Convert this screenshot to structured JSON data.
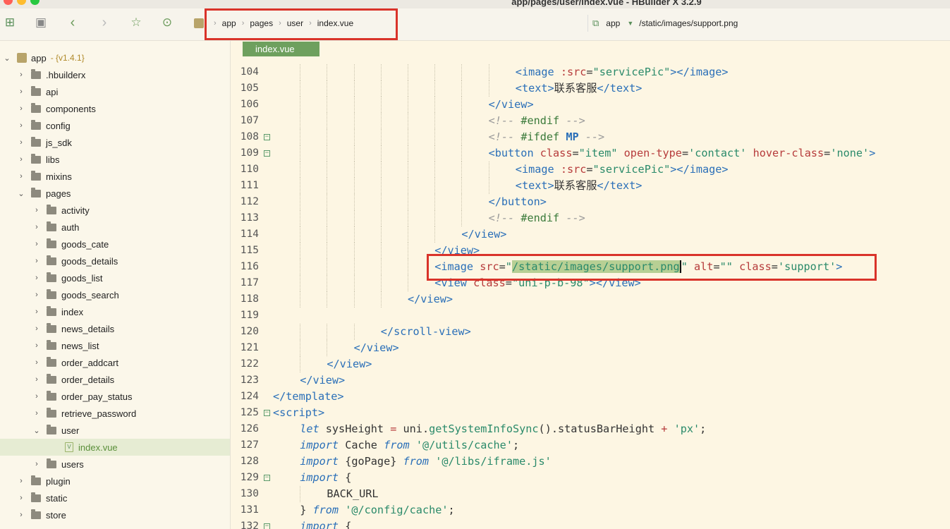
{
  "window": {
    "title": "app/pages/user/index.vue - HBuilder X 3.2.9"
  },
  "breadcrumb": [
    "app",
    "pages",
    "user",
    "index.vue"
  ],
  "right_breadcrumb": {
    "project": "app",
    "path": "/static/images/support.png"
  },
  "file_tab": "index.vue",
  "sidebar": {
    "items": [
      {
        "label": "app",
        "depth": 0,
        "kind": "project",
        "open": true,
        "version": "- {v1.4.1}"
      },
      {
        "label": ".hbuilderx",
        "depth": 1,
        "kind": "folder"
      },
      {
        "label": "api",
        "depth": 1,
        "kind": "folder"
      },
      {
        "label": "components",
        "depth": 1,
        "kind": "folder"
      },
      {
        "label": "config",
        "depth": 1,
        "kind": "folder"
      },
      {
        "label": "js_sdk",
        "depth": 1,
        "kind": "folder"
      },
      {
        "label": "libs",
        "depth": 1,
        "kind": "folder"
      },
      {
        "label": "mixins",
        "depth": 1,
        "kind": "folder"
      },
      {
        "label": "pages",
        "depth": 1,
        "kind": "folder",
        "open": true
      },
      {
        "label": "activity",
        "depth": 2,
        "kind": "folder"
      },
      {
        "label": "auth",
        "depth": 2,
        "kind": "folder"
      },
      {
        "label": "goods_cate",
        "depth": 2,
        "kind": "folder"
      },
      {
        "label": "goods_details",
        "depth": 2,
        "kind": "folder"
      },
      {
        "label": "goods_list",
        "depth": 2,
        "kind": "folder"
      },
      {
        "label": "goods_search",
        "depth": 2,
        "kind": "folder"
      },
      {
        "label": "index",
        "depth": 2,
        "kind": "folder"
      },
      {
        "label": "news_details",
        "depth": 2,
        "kind": "folder"
      },
      {
        "label": "news_list",
        "depth": 2,
        "kind": "folder"
      },
      {
        "label": "order_addcart",
        "depth": 2,
        "kind": "folder"
      },
      {
        "label": "order_details",
        "depth": 2,
        "kind": "folder"
      },
      {
        "label": "order_pay_status",
        "depth": 2,
        "kind": "folder"
      },
      {
        "label": "retrieve_password",
        "depth": 2,
        "kind": "folder"
      },
      {
        "label": "user",
        "depth": 2,
        "kind": "folder",
        "open": true
      },
      {
        "label": "index.vue",
        "depth": 3,
        "kind": "file",
        "selected": true
      },
      {
        "label": "users",
        "depth": 2,
        "kind": "folder"
      },
      {
        "label": "plugin",
        "depth": 1,
        "kind": "folder"
      },
      {
        "label": "static",
        "depth": 1,
        "kind": "folder"
      },
      {
        "label": "store",
        "depth": 1,
        "kind": "folder"
      }
    ]
  },
  "code_lines": [
    {
      "n": "104",
      "indent": 9,
      "tokens": [
        [
          "tg",
          "<image "
        ],
        [
          "at",
          ":src"
        ],
        [
          "pl",
          "="
        ],
        [
          "st",
          "\"servicePic\""
        ],
        [
          "tg",
          "></image>"
        ]
      ]
    },
    {
      "n": "105",
      "indent": 9,
      "tokens": [
        [
          "tg",
          "<text>"
        ],
        [
          "tx",
          "联系客服"
        ],
        [
          "tg",
          "</text>"
        ]
      ]
    },
    {
      "n": "106",
      "indent": 8,
      "tokens": [
        [
          "tg",
          "</view>"
        ]
      ]
    },
    {
      "n": "107",
      "indent": 8,
      "tokens": [
        [
          "cm",
          "<!-- "
        ],
        [
          "dir",
          "#endif"
        ],
        [
          "cm",
          " -->"
        ]
      ]
    },
    {
      "n": "108",
      "indent": 8,
      "fold": true,
      "tokens": [
        [
          "cm",
          "<!-- "
        ],
        [
          "dir",
          "#ifdef "
        ],
        [
          "mp",
          "MP"
        ],
        [
          "cm",
          " -->"
        ]
      ]
    },
    {
      "n": "109",
      "indent": 8,
      "fold": true,
      "tokens": [
        [
          "tg",
          "<button "
        ],
        [
          "at",
          "class"
        ],
        [
          "pl",
          "="
        ],
        [
          "st",
          "\"item\""
        ],
        [
          "pl",
          " "
        ],
        [
          "at",
          "open-type"
        ],
        [
          "pl",
          "="
        ],
        [
          "st",
          "'contact'"
        ],
        [
          "pl",
          " "
        ],
        [
          "at",
          "hover-class"
        ],
        [
          "pl",
          "="
        ],
        [
          "st",
          "'none'"
        ],
        [
          "tg",
          ">"
        ]
      ]
    },
    {
      "n": "110",
      "indent": 9,
      "tokens": [
        [
          "tg",
          "<image "
        ],
        [
          "at",
          ":src"
        ],
        [
          "pl",
          "="
        ],
        [
          "st",
          "\"servicePic\""
        ],
        [
          "tg",
          "></image>"
        ]
      ]
    },
    {
      "n": "111",
      "indent": 9,
      "tokens": [
        [
          "tg",
          "<text>"
        ],
        [
          "tx",
          "联系客服"
        ],
        [
          "tg",
          "</text>"
        ]
      ]
    },
    {
      "n": "112",
      "indent": 8,
      "tokens": [
        [
          "tg",
          "</button>"
        ]
      ]
    },
    {
      "n": "113",
      "indent": 8,
      "tokens": [
        [
          "cm",
          "<!-- "
        ],
        [
          "dir",
          "#endif"
        ],
        [
          "cm",
          " -->"
        ]
      ]
    },
    {
      "n": "114",
      "indent": 7,
      "tokens": [
        [
          "tg",
          "</view>"
        ]
      ]
    },
    {
      "n": "115",
      "indent": 6,
      "tokens": [
        [
          "tg",
          "</view>"
        ]
      ]
    },
    {
      "n": "116",
      "indent": 6,
      "tokens": [
        [
          "tg",
          "<image "
        ],
        [
          "at",
          "src"
        ],
        [
          "pl",
          "="
        ],
        [
          "st",
          "\""
        ],
        [
          "sel",
          "/static/images/support.png"
        ],
        [
          "caret",
          ""
        ],
        [
          "st",
          "\""
        ],
        [
          "pl",
          " "
        ],
        [
          "at",
          "alt"
        ],
        [
          "pl",
          "="
        ],
        [
          "st",
          "\"\""
        ],
        [
          "pl",
          " "
        ],
        [
          "at",
          "class"
        ],
        [
          "pl",
          "="
        ],
        [
          "st",
          "'support'"
        ],
        [
          "tg",
          ">"
        ]
      ]
    },
    {
      "n": "117",
      "indent": 6,
      "tokens": [
        [
          "tg",
          "<view "
        ],
        [
          "at",
          "class"
        ],
        [
          "pl",
          "="
        ],
        [
          "st",
          "\"uni-p-b-98\""
        ],
        [
          "tg",
          "></view>"
        ]
      ]
    },
    {
      "n": "118",
      "indent": 5,
      "tokens": [
        [
          "tg",
          "</view>"
        ]
      ]
    },
    {
      "n": "119",
      "indent": 0,
      "tokens": []
    },
    {
      "n": "120",
      "indent": 4,
      "tokens": [
        [
          "tg",
          "</scroll-view>"
        ]
      ]
    },
    {
      "n": "121",
      "indent": 3,
      "tokens": [
        [
          "tg",
          "</view>"
        ]
      ]
    },
    {
      "n": "122",
      "indent": 2,
      "tokens": [
        [
          "tg",
          "</view>"
        ]
      ]
    },
    {
      "n": "123",
      "indent": 1,
      "tokens": [
        [
          "tg",
          "</view>"
        ]
      ]
    },
    {
      "n": "124",
      "indent": 0,
      "tokens": [
        [
          "tg",
          "</template>"
        ]
      ]
    },
    {
      "n": "125",
      "indent": 0,
      "fold": true,
      "tokens": [
        [
          "tg",
          "<script>"
        ]
      ]
    },
    {
      "n": "126",
      "indent": 1,
      "tokens": [
        [
          "kw",
          "let"
        ],
        [
          "pl",
          " sysHeight "
        ],
        [
          "op",
          "="
        ],
        [
          "pl",
          " uni."
        ],
        [
          "fn",
          "getSystemInfoSync"
        ],
        [
          "pl",
          "().statusBarHeight "
        ],
        [
          "op",
          "+"
        ],
        [
          "pl",
          " "
        ],
        [
          "st",
          "'px'"
        ],
        [
          "pl",
          ";"
        ]
      ]
    },
    {
      "n": "127",
      "indent": 1,
      "tokens": [
        [
          "kw",
          "import"
        ],
        [
          "pl",
          " Cache "
        ],
        [
          "kw",
          "from"
        ],
        [
          "pl",
          " "
        ],
        [
          "st",
          "'@/utils/cache'"
        ],
        [
          "pl",
          ";"
        ]
      ]
    },
    {
      "n": "128",
      "indent": 1,
      "tokens": [
        [
          "kw",
          "import"
        ],
        [
          "pl",
          " {goPage} "
        ],
        [
          "kw",
          "from"
        ],
        [
          "pl",
          " "
        ],
        [
          "st",
          "'@/libs/iframe.js'"
        ]
      ]
    },
    {
      "n": "129",
      "indent": 1,
      "fold": true,
      "tokens": [
        [
          "kw",
          "import"
        ],
        [
          "pl",
          " {"
        ]
      ]
    },
    {
      "n": "130",
      "indent": 2,
      "tokens": [
        [
          "pl",
          "BACK_URL"
        ]
      ]
    },
    {
      "n": "131",
      "indent": 1,
      "tokens": [
        [
          "pl",
          "} "
        ],
        [
          "kw",
          "from"
        ],
        [
          "pl",
          " "
        ],
        [
          "st",
          "'@/config/cache'"
        ],
        [
          "pl",
          ";"
        ]
      ]
    },
    {
      "n": "132",
      "indent": 1,
      "fold": true,
      "tokens": [
        [
          "kw",
          "import"
        ],
        [
          "pl",
          " {"
        ]
      ]
    }
  ],
  "colors": {
    "accent": "#6ea05e",
    "highlight_box": "#d9332a",
    "editor_bg": "#fdf6e3"
  }
}
